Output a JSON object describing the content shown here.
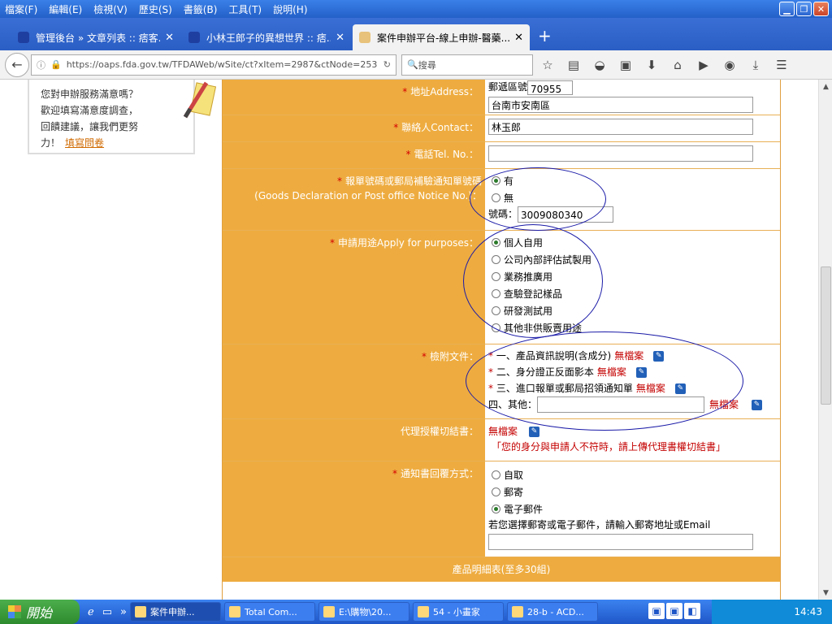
{
  "menu": [
    "檔案(F)",
    "編輯(E)",
    "檢視(V)",
    "歷史(S)",
    "書籤(B)",
    "工具(T)",
    "說明(H)"
  ],
  "tabs": [
    {
      "title": "管理後台 » 文章列表 :: 痞客..."
    },
    {
      "title": "小林王郎子的異想世界 :: 痞..."
    },
    {
      "title": "案件申辦平台-線上申辦-醫藥..."
    }
  ],
  "address": {
    "url": "https://oaps.fda.gov.tw/TFDAWeb/wSite/ct?xItem=2987&ctNode=253",
    "search_placeholder": "搜尋"
  },
  "survey": {
    "line1": "您對申辦服務滿意嗎？",
    "line2": "歡迎填寫滿意度調查，",
    "line3": "回饋建議，讓我們更努",
    "line4": "力！",
    "link": "填寫問卷"
  },
  "form": {
    "address_label": "地址Address：",
    "postcode_label": "郵遞區號",
    "postcode": "70955",
    "address_value": "台南市安南區",
    "contact_label": "聯絡人Contact：",
    "contact_value": "林玉郎",
    "tel_label": "電話Tel. No.：",
    "tel_value": "",
    "decl_label1": "報單號碼或郵局補驗通知單號碼",
    "decl_label2": "(Goods Declaration or Post office Notice No.)：",
    "decl_yes": "有",
    "decl_no": "無",
    "decl_num_label": "號碼：",
    "decl_num": "3009080340",
    "purpose_label": "申請用途Apply for purposes：",
    "purposes": [
      "個人自用",
      "公司內部評估試製用",
      "業務推廣用",
      "查驗登記樣品",
      "研發測試用",
      "其他非供販賣用途"
    ],
    "purpose_selected": 0,
    "attach_label": "檢附文件：",
    "attach": [
      {
        "text": "一、產品資訊說明(含成分)",
        "status": "無檔案"
      },
      {
        "text": "二、身分證正反面影本",
        "status": "無檔案"
      },
      {
        "text": "三、進口報單或郵局招領通知單",
        "status": "無檔案"
      }
    ],
    "other_label": "四、其他：",
    "other_status": "無檔案",
    "proxy_label": "代理授權切結書：",
    "proxy_status": "無檔案",
    "proxy_note": "「您的身分與申請人不符時，請上傳代理書權切結書」",
    "reply_label": "通知書回覆方式：",
    "reply_options": [
      "自取",
      "郵寄",
      "電子郵件"
    ],
    "reply_selected": 2,
    "reply_note": "若您選擇郵寄或電子郵件，請輸入郵寄地址或Email",
    "section_title": "產品明細表(至多30組)"
  },
  "taskbar": {
    "start": "開始",
    "tasks": [
      "案件申辦...",
      "Total Com...",
      "E:\\購物\\20...",
      "54 - 小畫家",
      "28-b - ACD..."
    ],
    "clock": "14:43"
  }
}
